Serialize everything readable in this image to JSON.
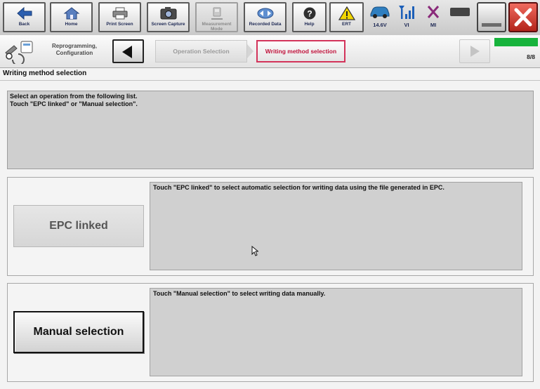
{
  "toolbar": {
    "buttons": [
      {
        "label": "Back",
        "icon": "back-arrow-icon"
      },
      {
        "label": "Home",
        "icon": "home-icon"
      },
      {
        "label": "Print Screen",
        "icon": "printer-icon"
      },
      {
        "label": "Screen Capture",
        "icon": "camera-icon"
      },
      {
        "label": "Measurement Mode",
        "icon": "measurement-icon"
      },
      {
        "label": "Recorded Data",
        "icon": "recorded-data-icon"
      },
      {
        "label": "Help",
        "icon": "help-icon"
      },
      {
        "label": "ERT",
        "icon": "warning-icon"
      }
    ],
    "status": {
      "battery_voltage": "14.6V",
      "vi_label": "VI",
      "mi_label": "MI"
    },
    "colors": {
      "accent": "#1f2a55",
      "close": "#c8362a"
    }
  },
  "breadcrumb": {
    "section": "Reprogramming, Configuration",
    "steps": [
      {
        "label": "Operation Selection",
        "state": "completed"
      },
      {
        "label": "Writing method selection",
        "state": "current"
      }
    ],
    "progress_text": "8/8",
    "progress_fraction": 1.0,
    "progress_color": "#17b33c",
    "current_step_color": "#c0123b"
  },
  "page": {
    "title": "Writing method selection",
    "instructions": [
      "Select an operation from the following list.",
      "Touch \"EPC linked\" or \"Manual selection\"."
    ]
  },
  "options": [
    {
      "label": "EPC linked",
      "description": "Touch \"EPC linked\" to select automatic selection for writing data using the file generated in EPC.",
      "enabled": false
    },
    {
      "label": "Manual selection",
      "description": "Touch \"Manual selection\" to select writing data manually.",
      "enabled": true
    }
  ]
}
